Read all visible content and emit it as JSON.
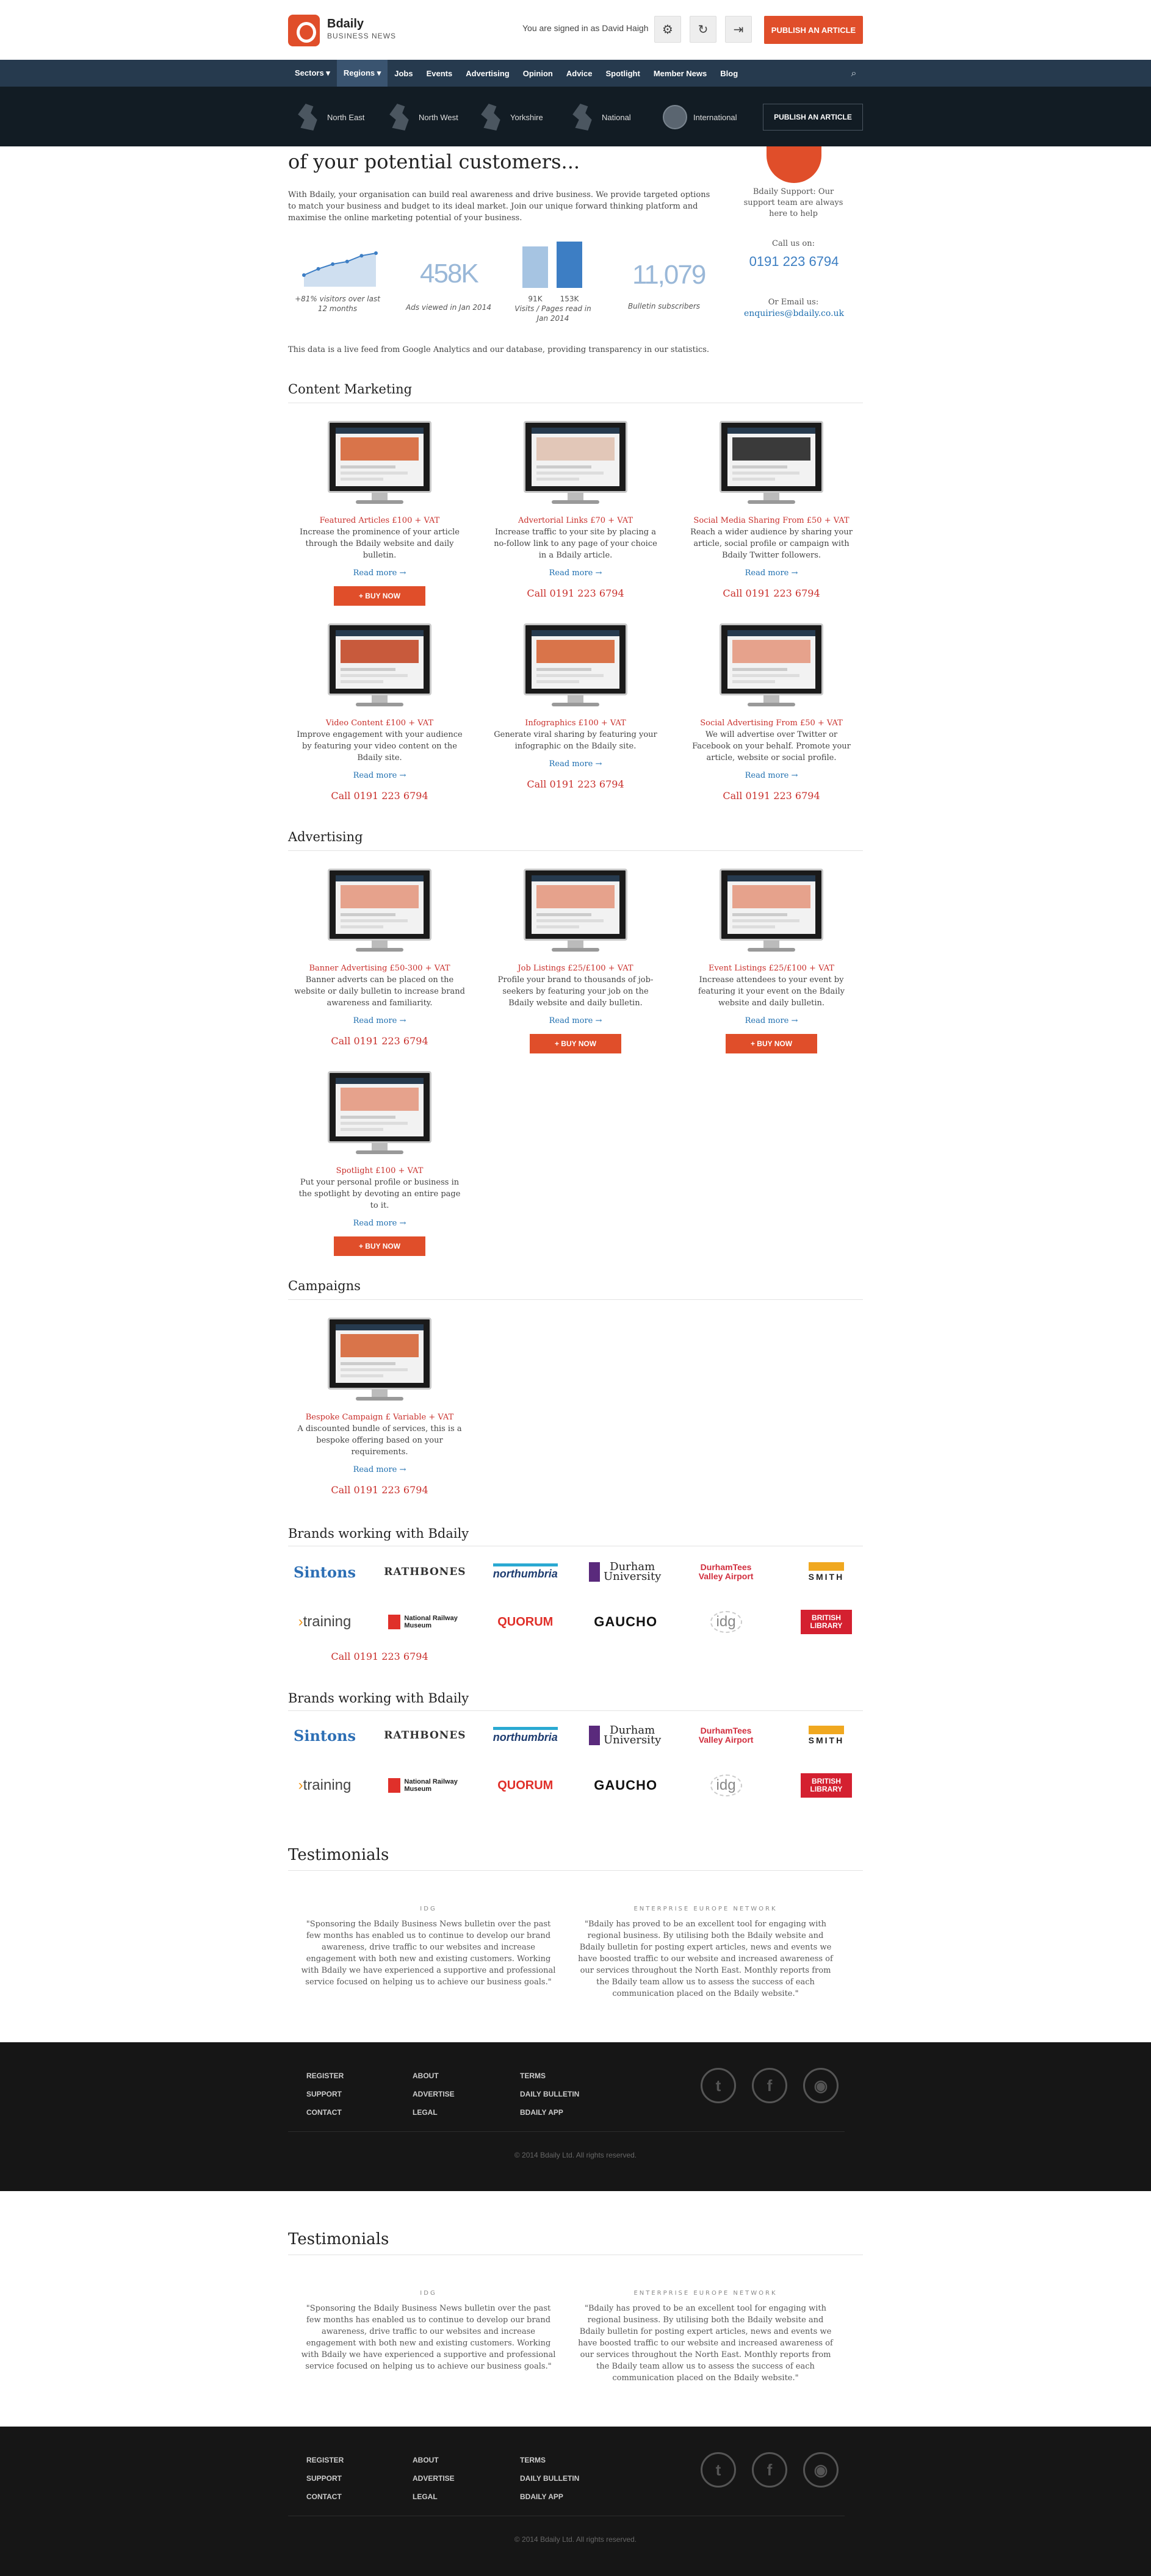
{
  "header": {
    "brand": "Bdaily",
    "brand_sub": "BUSINESS NEWS",
    "signed_in": "You are signed in as David Haigh",
    "publish": "PUBLISH AN ARTICLE"
  },
  "nav": {
    "items": [
      "Sectors ▾",
      "Regions ▾",
      "Jobs",
      "Events",
      "Advertising",
      "Opinion",
      "Advice",
      "Spotlight",
      "Member News",
      "Blog"
    ],
    "regions": [
      "North East",
      "North West",
      "Yorkshire",
      "National",
      "International"
    ],
    "publish2": "PUBLISH AN ARTICLE"
  },
  "intro": {
    "heading": "of your potential customers...",
    "text": "With Bdaily, your organisation can build real awareness and drive business. We provide targeted options to match your business and budget to its ideal market. Join our unique forward thinking platform and maximise the online marketing potential of your business.",
    "support": "Bdaily Support: Our support team are always here to help",
    "call_us": "Call us on:",
    "phone": "0191 223 6794",
    "email_label": "Or Email us:",
    "email": "enquiries@bdaily.co.uk",
    "live_data": "This data is a live feed from Google Analytics and our database, providing transparency in our statistics."
  },
  "stats": {
    "visitors_label": "+81% visitors over last 12 months",
    "visitors_trend": [
      0.25,
      0.42,
      0.55,
      0.62,
      0.78,
      0.85
    ],
    "ads": "458K",
    "ads_label": "Ads viewed in Jan 2014",
    "visits_label": "Visits / Pages read in Jan 2014",
    "visits_bar_1": "91K",
    "visits_bar_2": "153K",
    "bar_colors": [
      "#a6c4e2",
      "#3d7ec4"
    ],
    "subscribers": "11,079",
    "subscribers_label": "Bulletin subscribers"
  },
  "content_marketing": {
    "title": "Content Marketing",
    "items": [
      {
        "title": "Featured Articles £100 + VAT",
        "desc": "Increase the prominence of your article through the Bdaily website and daily bulletin.",
        "more": "Read more →",
        "action": "+ BUY NOW"
      },
      {
        "title": "Advertorial Links £70 + VAT",
        "desc": "Increase traffic to your site by placing a no-follow link to any page of your choice in a Bdaily article.",
        "more": "Read more →",
        "action": "Call 0191 223 6794"
      },
      {
        "title": "Social Media Sharing From £50 + VAT",
        "desc": "Reach a wider audience by sharing your article, social profile or campaign with Bdaily Twitter followers.",
        "more": "Read more →",
        "action": "Call 0191 223 6794"
      },
      {
        "title": "Video Content £100 + VAT",
        "desc": "Improve engagement with your audience by featuring your video content on the Bdaily site.",
        "more": "Read more →",
        "action": "Call 0191 223 6794"
      },
      {
        "title": "Infographics £100 + VAT",
        "desc": "Generate viral sharing by featuring your infographic on the Bdaily site.",
        "more": "Read more →",
        "action": "Call 0191 223 6794"
      },
      {
        "title": "Social Advertising From £50 + VAT",
        "desc": "We will advertise over Twitter or Facebook on your behalf. Promote your article, website or social profile.",
        "more": "Read more →",
        "action": "Call 0191 223 6794"
      }
    ]
  },
  "advertising": {
    "title": "Advertising",
    "items": [
      {
        "title": "Banner Advertising £50-300 + VAT",
        "desc": "Banner adverts can be placed on the website or daily bulletin to increase brand awareness and familiarity.",
        "more": "Read more →",
        "action": "Call 0191 223 6794"
      },
      {
        "title": "Job Listings £25/£100 + VAT",
        "desc": "Profile your brand to thousands of job-seekers by featuring your job on the Bdaily website and daily bulletin.",
        "more": "Read more →",
        "action": "+ BUY NOW"
      },
      {
        "title": "Event Listings £25/£100 + VAT",
        "desc": "Increase attendees to your event by featuring it your event on the Bdaily website and daily bulletin.",
        "more": "Read more →",
        "action": "+ BUY NOW"
      },
      {
        "title": "Spotlight £100 + VAT",
        "desc": "Put your personal profile or business in the spotlight by devoting an entire page to it.",
        "more": "Read more →",
        "action": "+ BUY NOW"
      }
    ]
  },
  "campaigns": {
    "title": "Campaigns",
    "item": {
      "title": "Bespoke Campaign £ Variable + VAT",
      "desc": "A discounted bundle of services, this is a bespoke offering based on your requirements.",
      "more": "Read more →",
      "action": "Call 0191 223 6794"
    }
  },
  "brands": {
    "title": "Brands working with Bdaily",
    "row1": [
      "Sintons",
      "RATHBONES",
      "northumbria",
      "Durham University",
      "DurhamTees Valley Airport",
      "SMITH"
    ],
    "row2": [
      "training",
      "National Railway Museum",
      "QUORUM",
      "GAUCHO",
      "idg",
      "BRITISH LIBRARY"
    ],
    "call": "Call 0191 223 6794",
    "title2": "Brands working with Bdaily"
  },
  "testimonials": {
    "title": "Testimonials",
    "items": [
      {
        "source": "IDG",
        "quote": "\"Sponsoring the Bdaily Business News bulletin over the past few months has enabled us to continue to develop our brand awareness, drive traffic to our websites and increase engagement with both new and existing customers. Working with Bdaily we have experienced a supportive and professional service focused on helping us to achieve our business goals.\""
      },
      {
        "source": "ENTERPRISE EUROPE NETWORK",
        "quote": "\"Bdaily has proved to be an excellent tool for engaging with regional business. By utilising both the Bdaily website and Bdaily bulletin for posting expert articles, news and events we have boosted traffic to our website and increased awareness of our services throughout the North East. Monthly reports from the Bdaily team allow us to assess the success of each communication placed on the Bdaily website.\""
      }
    ]
  },
  "footer": {
    "col1": [
      "REGISTER",
      "SUPPORT",
      "CONTACT"
    ],
    "col2": [
      "ABOUT",
      "ADVERTISE",
      "LEGAL"
    ],
    "col3": [
      "TERMS",
      "DAILY BULLETIN",
      "BDAILY APP"
    ],
    "social": [
      "twitter-icon",
      "facebook-icon",
      "rss-icon"
    ],
    "copyright": "© 2014 Bdaily Ltd. All rights reserved."
  }
}
